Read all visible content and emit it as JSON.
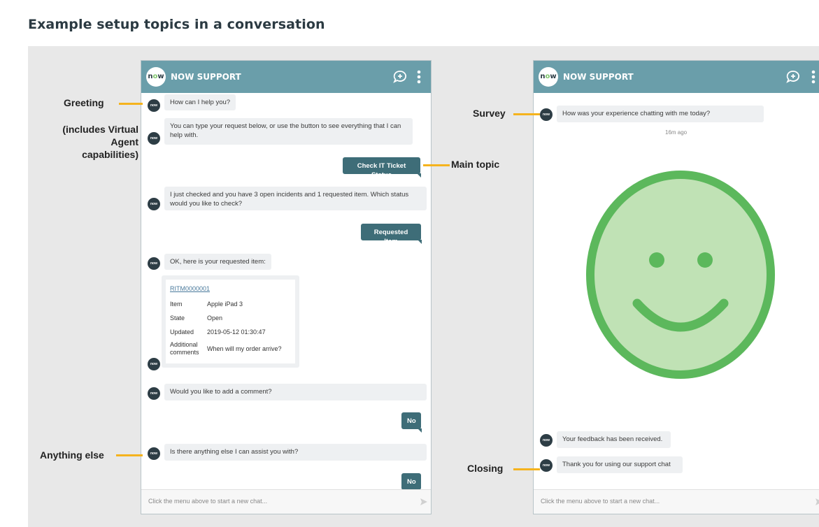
{
  "page": {
    "title": "Example setup topics in a conversation"
  },
  "brand": {
    "logo_text_n": "n",
    "logo_text_o": "o",
    "logo_text_w": "w",
    "name": "NOW SUPPORT",
    "avatar_text": "now"
  },
  "colors": {
    "header": "#6a9eaa",
    "user_bubble": "#3e6d78",
    "callout_line": "#f5b31e",
    "smiley_fill": "#c0e2b5",
    "smiley_stroke": "#5cb85c"
  },
  "icons": {
    "header_new_chat": "chat-plus-icon",
    "header_menu": "vertical-dots-icon",
    "footer_send": "send-icon"
  },
  "left_chat": {
    "messages": {
      "greeting": "How can I help you?",
      "capabilities": "You can type your request below, or use the button to see everything that I can help with.",
      "check_status": "Check IT Ticket Status",
      "incidents": "I just checked and you have 3 open incidents and 1 requested item.  Which status would you like to check?",
      "requested_item": "Requested Item",
      "here_is": "OK, here is your requested item:",
      "add_comment": "Would you like to add a comment?",
      "no_1": "No",
      "anything_else": "Is there anything else I can assist you with?",
      "no_2": "No"
    },
    "card": {
      "link": "RITM0000001",
      "rows": [
        {
          "label": "Item",
          "value": "Apple iPad 3"
        },
        {
          "label": "State",
          "value": "Open"
        },
        {
          "label": "Updated",
          "value": "2019-05-12 01:30:47"
        },
        {
          "label": "Additional comments",
          "value": "When will my order arrive?"
        }
      ]
    },
    "footer_placeholder": "Click the menu above to start a new chat..."
  },
  "right_chat": {
    "messages": {
      "survey": "How was your experience chatting with me today?",
      "timestamp": "16m ago",
      "feedback": "Your feedback has been received.",
      "thanks": "Thank you for using our support chat"
    },
    "footer_placeholder": "Click the menu above to start a new chat..."
  },
  "callouts": {
    "greeting": "Greeting",
    "greeting_note": "(includes Virtual Agent capabilities)",
    "main_topic": "Main topic",
    "anything_else": "Anything else",
    "survey": "Survey",
    "closing": "Closing"
  }
}
